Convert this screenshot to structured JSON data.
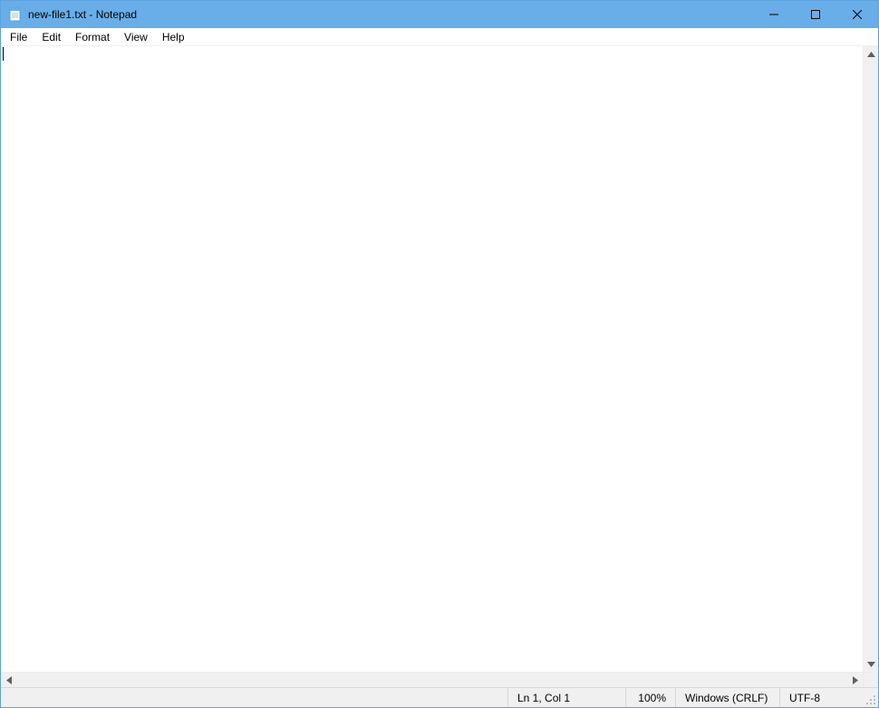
{
  "titlebar": {
    "title": "new-file1.txt - Notepad",
    "icon": "notepad-icon"
  },
  "menu": {
    "items": [
      "File",
      "Edit",
      "Format",
      "View",
      "Help"
    ]
  },
  "editor": {
    "content": ""
  },
  "statusbar": {
    "position": "Ln 1, Col 1",
    "zoom": "100%",
    "line_ending": "Windows (CRLF)",
    "encoding": "UTF-8"
  }
}
